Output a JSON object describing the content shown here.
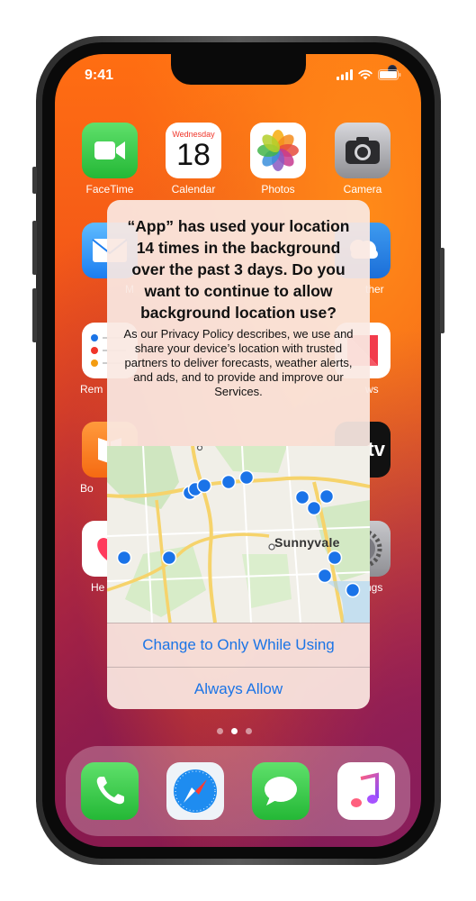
{
  "status": {
    "time": "9:41"
  },
  "apps": {
    "facetime": {
      "label": "FaceTime"
    },
    "calendar": {
      "label": "Calendar",
      "weekday": "Wednesday",
      "day": "18"
    },
    "photos": {
      "label": "Photos"
    },
    "camera": {
      "label": "Camera"
    },
    "mail": {
      "label": "M"
    },
    "weather": {
      "label": "ther"
    },
    "reminders": {
      "label": "Rem"
    },
    "news": {
      "label": "ws"
    },
    "books": {
      "label": "Bo"
    },
    "tv": {
      "label": "",
      "glyph": "tv"
    },
    "health": {
      "label": "He"
    },
    "settings": {
      "label": "ngs"
    }
  },
  "alert": {
    "title": "“App” has used your location 14 times in the background over the past 3 days. Do you want to continue to allow background location use?",
    "message": "As our Privacy Policy describes, we use and share your device’s location with trusted partners to deliver forecasts, weather alerts, and ads, and to provide and improve our Services.",
    "map_city_label": "Sunnyvale",
    "buttons": {
      "primary": "Change to Only While Using",
      "secondary": "Always Allow"
    }
  },
  "page_indicator": {
    "count": 3,
    "active": 2
  },
  "dock": [
    "phone-icon",
    "safari-icon",
    "messages-icon",
    "music-icon"
  ],
  "colors": {
    "accent": "#1b74e6",
    "location_pin": "#1a73e8"
  }
}
